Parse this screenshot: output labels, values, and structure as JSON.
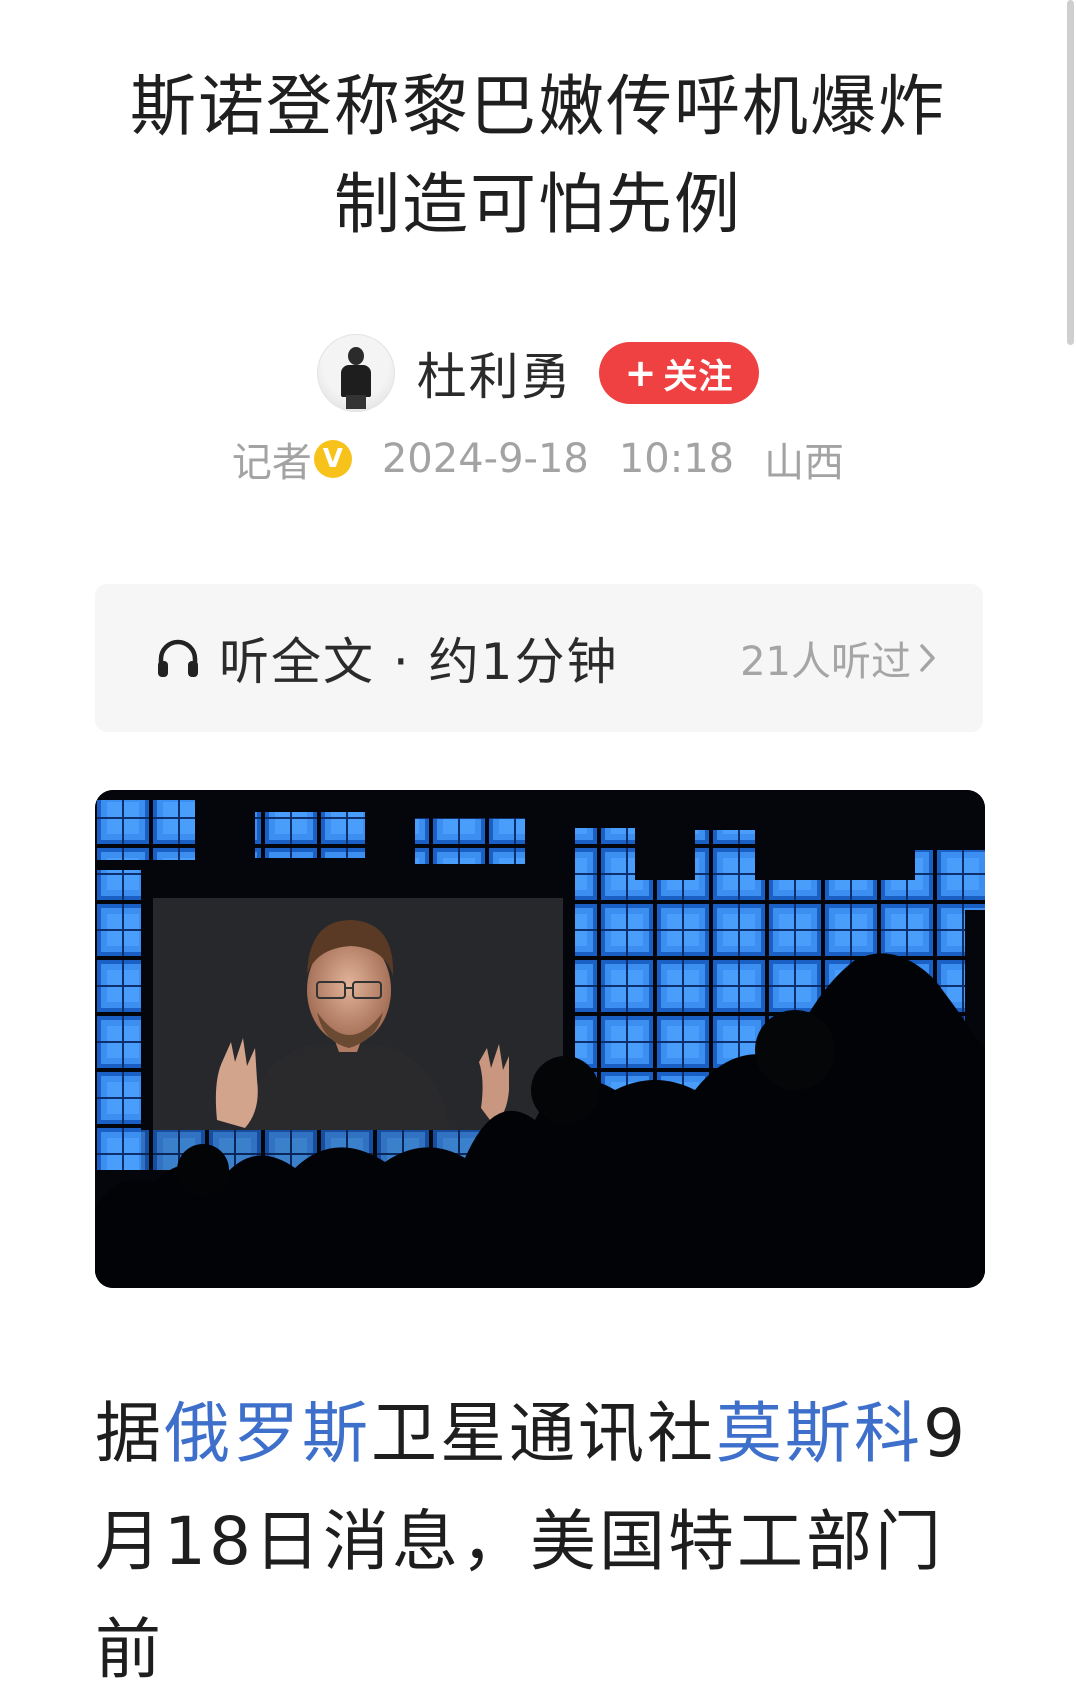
{
  "article": {
    "title_line1": "斯诺登称黎巴嫩传呼机爆炸",
    "title_line2": "制造可怕先例",
    "author": {
      "name": "杜利勇",
      "follow_label": "关注",
      "role": "记者",
      "verified_badge": "V",
      "date": "2024-9-18",
      "time": "10:18",
      "location": "山西"
    },
    "listen": {
      "label": "听全文 · 约1分钟",
      "count": "21人听过",
      "icon": "headphone-icon"
    },
    "photo": {
      "alt": "Edward Snowden on a large screen at a conference stage"
    },
    "body": {
      "t1": "据",
      "link1": "俄罗斯",
      "t2": "卫星通讯社",
      "link2": "莫斯科",
      "t3": "9月18日消息，美国特工部门前"
    }
  },
  "colors": {
    "follow_button": "#f04142",
    "link": "#3d6fcb",
    "meta_text": "#a3a3a3",
    "verify_badge": "#f7c21a"
  }
}
